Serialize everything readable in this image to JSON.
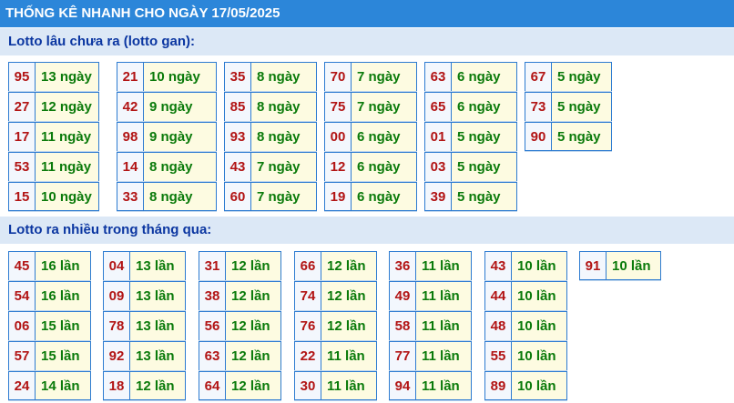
{
  "header": {
    "title": "THỐNG KÊ NHANH CHO NGÀY 17/05/2025"
  },
  "gan": {
    "title": "Lotto lâu chưa ra (lotto gan):",
    "columns": [
      [
        {
          "num": "95",
          "count": "13 ngày"
        },
        {
          "num": "27",
          "count": "12 ngày"
        },
        {
          "num": "17",
          "count": "11 ngày"
        },
        {
          "num": "53",
          "count": "11 ngày"
        },
        {
          "num": "15",
          "count": "10 ngày"
        }
      ],
      [
        {
          "num": "21",
          "count": "10 ngày"
        },
        {
          "num": "42",
          "count": "9 ngày"
        },
        {
          "num": "98",
          "count": "9 ngày"
        },
        {
          "num": "14",
          "count": "8 ngày"
        },
        {
          "num": "33",
          "count": "8 ngày"
        }
      ],
      [
        {
          "num": "35",
          "count": "8 ngày"
        },
        {
          "num": "85",
          "count": "8 ngày"
        },
        {
          "num": "93",
          "count": "8 ngày"
        },
        {
          "num": "43",
          "count": "7 ngày"
        },
        {
          "num": "60",
          "count": "7 ngày"
        }
      ],
      [
        {
          "num": "70",
          "count": "7 ngày"
        },
        {
          "num": "75",
          "count": "7 ngày"
        },
        {
          "num": "00",
          "count": "6 ngày"
        },
        {
          "num": "12",
          "count": "6 ngày"
        },
        {
          "num": "19",
          "count": "6 ngày"
        }
      ],
      [
        {
          "num": "63",
          "count": "6 ngày"
        },
        {
          "num": "65",
          "count": "6 ngày"
        },
        {
          "num": "01",
          "count": "5 ngày"
        },
        {
          "num": "03",
          "count": "5 ngày"
        },
        {
          "num": "39",
          "count": "5 ngày"
        }
      ],
      [
        {
          "num": "67",
          "count": "5 ngày"
        },
        {
          "num": "73",
          "count": "5 ngày"
        },
        {
          "num": "90",
          "count": "5 ngày"
        }
      ]
    ]
  },
  "frequent": {
    "title": "Lotto ra nhiều trong tháng qua:",
    "columns": [
      [
        {
          "num": "45",
          "count": "16 lần"
        },
        {
          "num": "54",
          "count": "16 lần"
        },
        {
          "num": "06",
          "count": "15 lần"
        },
        {
          "num": "57",
          "count": "15 lần"
        },
        {
          "num": "24",
          "count": "14 lần"
        }
      ],
      [
        {
          "num": "04",
          "count": "13 lần"
        },
        {
          "num": "09",
          "count": "13 lần"
        },
        {
          "num": "78",
          "count": "13 lần"
        },
        {
          "num": "92",
          "count": "13 lần"
        },
        {
          "num": "18",
          "count": "12 lần"
        }
      ],
      [
        {
          "num": "31",
          "count": "12 lần"
        },
        {
          "num": "38",
          "count": "12 lần"
        },
        {
          "num": "56",
          "count": "12 lần"
        },
        {
          "num": "63",
          "count": "12 lần"
        },
        {
          "num": "64",
          "count": "12 lần"
        }
      ],
      [
        {
          "num": "66",
          "count": "12 lần"
        },
        {
          "num": "74",
          "count": "12 lần"
        },
        {
          "num": "76",
          "count": "12 lần"
        },
        {
          "num": "22",
          "count": "11 lần"
        },
        {
          "num": "30",
          "count": "11 lần"
        }
      ],
      [
        {
          "num": "36",
          "count": "11 lần"
        },
        {
          "num": "49",
          "count": "11 lần"
        },
        {
          "num": "58",
          "count": "11 lần"
        },
        {
          "num": "77",
          "count": "11 lần"
        },
        {
          "num": "94",
          "count": "11 lần"
        }
      ],
      [
        {
          "num": "43",
          "count": "10 lần"
        },
        {
          "num": "44",
          "count": "10 lần"
        },
        {
          "num": "48",
          "count": "10 lần"
        },
        {
          "num": "55",
          "count": "10 lần"
        },
        {
          "num": "89",
          "count": "10 lần"
        }
      ],
      [
        {
          "num": "91",
          "count": "10 lần"
        }
      ]
    ]
  }
}
